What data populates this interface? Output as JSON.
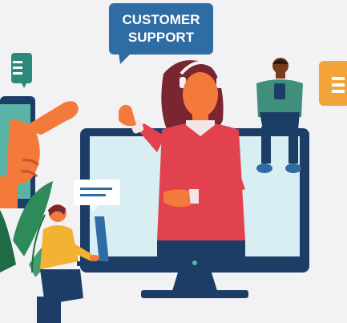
{
  "illustration": {
    "bubble_line1": "CUSTOMER",
    "bubble_line2": "SUPPORT"
  },
  "colors": {
    "background": "#f2f2f4",
    "bubble_blue": "#2f6ca3",
    "monitor_navy": "#1c3d66",
    "screen_light": "#d8eef2",
    "agent_red": "#e2424e",
    "skin": "#f47a3c",
    "hair": "#7a2530",
    "teal_shirt": "#3f8f7c",
    "yellow_shirt": "#f2b233",
    "plant_green": "#2f8a5a",
    "orange_chat": "#f2a33a"
  }
}
